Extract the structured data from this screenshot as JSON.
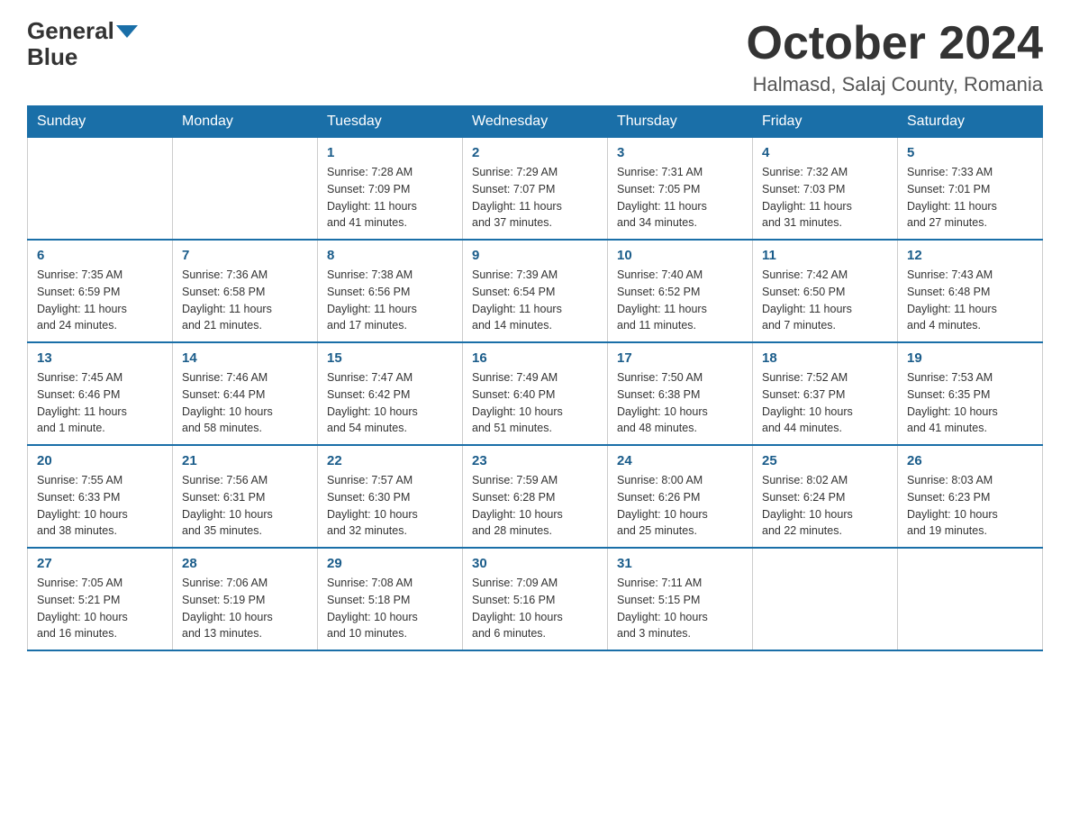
{
  "header": {
    "logo_general": "General",
    "logo_blue": "Blue",
    "month_title": "October 2024",
    "location": "Halmasd, Salaj County, Romania"
  },
  "weekdays": [
    "Sunday",
    "Monday",
    "Tuesday",
    "Wednesday",
    "Thursday",
    "Friday",
    "Saturday"
  ],
  "weeks": [
    [
      {
        "day": "",
        "info": ""
      },
      {
        "day": "",
        "info": ""
      },
      {
        "day": "1",
        "info": "Sunrise: 7:28 AM\nSunset: 7:09 PM\nDaylight: 11 hours\nand 41 minutes."
      },
      {
        "day": "2",
        "info": "Sunrise: 7:29 AM\nSunset: 7:07 PM\nDaylight: 11 hours\nand 37 minutes."
      },
      {
        "day": "3",
        "info": "Sunrise: 7:31 AM\nSunset: 7:05 PM\nDaylight: 11 hours\nand 34 minutes."
      },
      {
        "day": "4",
        "info": "Sunrise: 7:32 AM\nSunset: 7:03 PM\nDaylight: 11 hours\nand 31 minutes."
      },
      {
        "day": "5",
        "info": "Sunrise: 7:33 AM\nSunset: 7:01 PM\nDaylight: 11 hours\nand 27 minutes."
      }
    ],
    [
      {
        "day": "6",
        "info": "Sunrise: 7:35 AM\nSunset: 6:59 PM\nDaylight: 11 hours\nand 24 minutes."
      },
      {
        "day": "7",
        "info": "Sunrise: 7:36 AM\nSunset: 6:58 PM\nDaylight: 11 hours\nand 21 minutes."
      },
      {
        "day": "8",
        "info": "Sunrise: 7:38 AM\nSunset: 6:56 PM\nDaylight: 11 hours\nand 17 minutes."
      },
      {
        "day": "9",
        "info": "Sunrise: 7:39 AM\nSunset: 6:54 PM\nDaylight: 11 hours\nand 14 minutes."
      },
      {
        "day": "10",
        "info": "Sunrise: 7:40 AM\nSunset: 6:52 PM\nDaylight: 11 hours\nand 11 minutes."
      },
      {
        "day": "11",
        "info": "Sunrise: 7:42 AM\nSunset: 6:50 PM\nDaylight: 11 hours\nand 7 minutes."
      },
      {
        "day": "12",
        "info": "Sunrise: 7:43 AM\nSunset: 6:48 PM\nDaylight: 11 hours\nand 4 minutes."
      }
    ],
    [
      {
        "day": "13",
        "info": "Sunrise: 7:45 AM\nSunset: 6:46 PM\nDaylight: 11 hours\nand 1 minute."
      },
      {
        "day": "14",
        "info": "Sunrise: 7:46 AM\nSunset: 6:44 PM\nDaylight: 10 hours\nand 58 minutes."
      },
      {
        "day": "15",
        "info": "Sunrise: 7:47 AM\nSunset: 6:42 PM\nDaylight: 10 hours\nand 54 minutes."
      },
      {
        "day": "16",
        "info": "Sunrise: 7:49 AM\nSunset: 6:40 PM\nDaylight: 10 hours\nand 51 minutes."
      },
      {
        "day": "17",
        "info": "Sunrise: 7:50 AM\nSunset: 6:38 PM\nDaylight: 10 hours\nand 48 minutes."
      },
      {
        "day": "18",
        "info": "Sunrise: 7:52 AM\nSunset: 6:37 PM\nDaylight: 10 hours\nand 44 minutes."
      },
      {
        "day": "19",
        "info": "Sunrise: 7:53 AM\nSunset: 6:35 PM\nDaylight: 10 hours\nand 41 minutes."
      }
    ],
    [
      {
        "day": "20",
        "info": "Sunrise: 7:55 AM\nSunset: 6:33 PM\nDaylight: 10 hours\nand 38 minutes."
      },
      {
        "day": "21",
        "info": "Sunrise: 7:56 AM\nSunset: 6:31 PM\nDaylight: 10 hours\nand 35 minutes."
      },
      {
        "day": "22",
        "info": "Sunrise: 7:57 AM\nSunset: 6:30 PM\nDaylight: 10 hours\nand 32 minutes."
      },
      {
        "day": "23",
        "info": "Sunrise: 7:59 AM\nSunset: 6:28 PM\nDaylight: 10 hours\nand 28 minutes."
      },
      {
        "day": "24",
        "info": "Sunrise: 8:00 AM\nSunset: 6:26 PM\nDaylight: 10 hours\nand 25 minutes."
      },
      {
        "day": "25",
        "info": "Sunrise: 8:02 AM\nSunset: 6:24 PM\nDaylight: 10 hours\nand 22 minutes."
      },
      {
        "day": "26",
        "info": "Sunrise: 8:03 AM\nSunset: 6:23 PM\nDaylight: 10 hours\nand 19 minutes."
      }
    ],
    [
      {
        "day": "27",
        "info": "Sunrise: 7:05 AM\nSunset: 5:21 PM\nDaylight: 10 hours\nand 16 minutes."
      },
      {
        "day": "28",
        "info": "Sunrise: 7:06 AM\nSunset: 5:19 PM\nDaylight: 10 hours\nand 13 minutes."
      },
      {
        "day": "29",
        "info": "Sunrise: 7:08 AM\nSunset: 5:18 PM\nDaylight: 10 hours\nand 10 minutes."
      },
      {
        "day": "30",
        "info": "Sunrise: 7:09 AM\nSunset: 5:16 PM\nDaylight: 10 hours\nand 6 minutes."
      },
      {
        "day": "31",
        "info": "Sunrise: 7:11 AM\nSunset: 5:15 PM\nDaylight: 10 hours\nand 3 minutes."
      },
      {
        "day": "",
        "info": ""
      },
      {
        "day": "",
        "info": ""
      }
    ]
  ]
}
